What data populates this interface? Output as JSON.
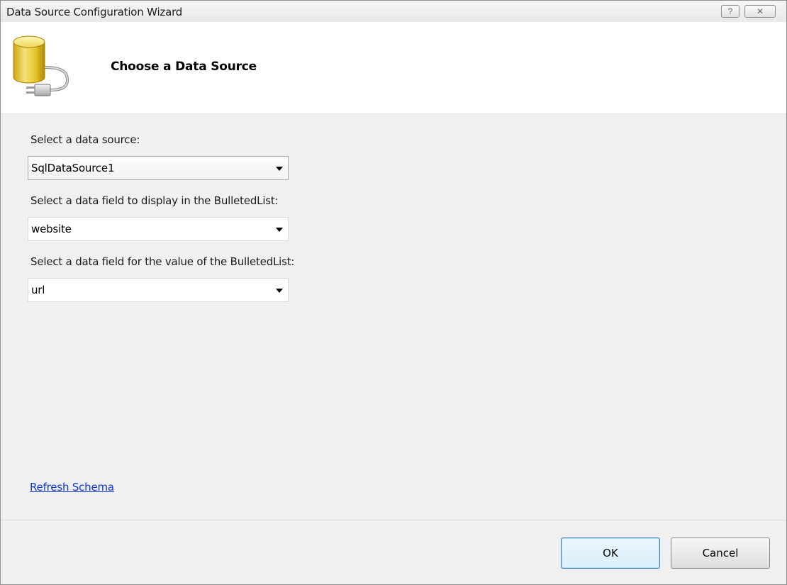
{
  "window": {
    "title": "Data Source Configuration Wizard",
    "help_button": "?",
    "close_button": "✕"
  },
  "header": {
    "title": "Choose a Data Source",
    "icon": "database-plug-icon"
  },
  "form": {
    "data_source": {
      "label": "Select a data source:",
      "value": "SqlDataSource1"
    },
    "display_field": {
      "label": "Select a data field to display in the BulletedList:",
      "value": "website"
    },
    "value_field": {
      "label": "Select a data field for the value of the BulletedList:",
      "value": "url"
    }
  },
  "links": {
    "refresh_schema": "Refresh Schema"
  },
  "buttons": {
    "ok": "OK",
    "cancel": "Cancel"
  },
  "colors": {
    "link": "#0d38d8",
    "header_bg": "#ffffff",
    "body_bg": "#f0f0f0",
    "default_button_border": "#3c7fb1"
  }
}
